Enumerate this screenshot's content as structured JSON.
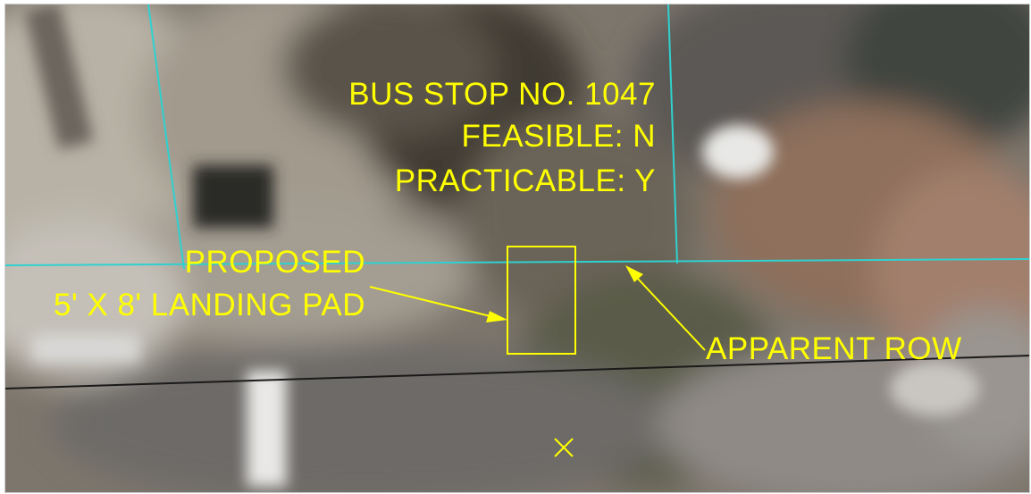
{
  "stop_info": {
    "line1": "BUS STOP NO. 1047",
    "line2": "FEASIBLE: N",
    "line3": "PRACTICABLE: Y"
  },
  "proposed_label": {
    "line1": "PROPOSED",
    "line2": "5' X 8' LANDING PAD"
  },
  "row_label": "APPARENT ROW",
  "colors": {
    "annotation": "#ffff00",
    "parcel_lines": "#2fd1cf",
    "road_edge": "#1a1a1a"
  },
  "icons": {
    "marker": "x-marker-icon"
  }
}
